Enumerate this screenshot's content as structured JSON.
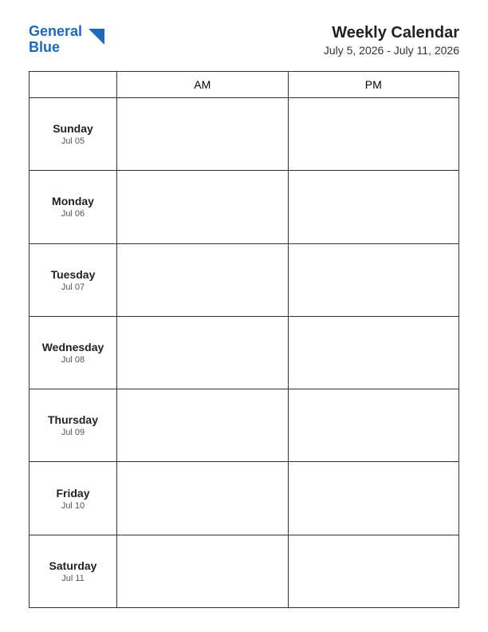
{
  "header": {
    "logo": {
      "text_general": "General",
      "text_blue": "Blue"
    },
    "title": "Weekly Calendar",
    "date_range": "July 5, 2026 - July 11, 2026"
  },
  "table": {
    "col_day_header": "",
    "col_am_header": "AM",
    "col_pm_header": "PM",
    "rows": [
      {
        "day_name": "Sunday",
        "day_date": "Jul 05"
      },
      {
        "day_name": "Monday",
        "day_date": "Jul 06"
      },
      {
        "day_name": "Tuesday",
        "day_date": "Jul 07"
      },
      {
        "day_name": "Wednesday",
        "day_date": "Jul 08"
      },
      {
        "day_name": "Thursday",
        "day_date": "Jul 09"
      },
      {
        "day_name": "Friday",
        "day_date": "Jul 10"
      },
      {
        "day_name": "Saturday",
        "day_date": "Jul 11"
      }
    ]
  }
}
